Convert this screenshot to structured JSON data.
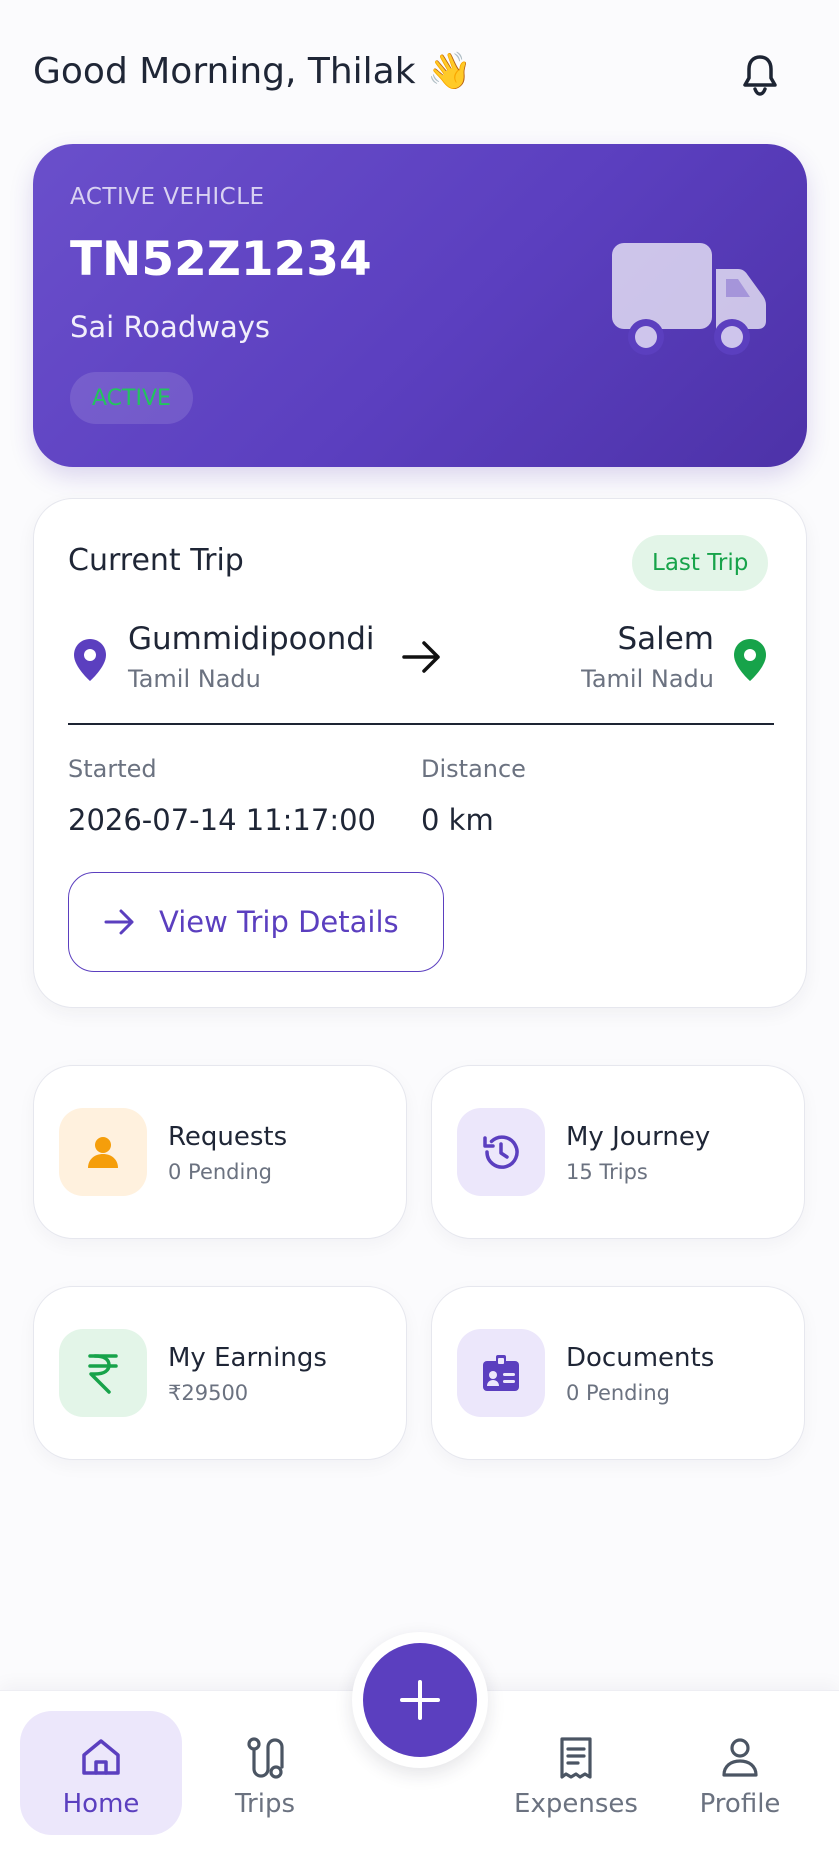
{
  "header": {
    "greeting": "Good Morning, Thilak",
    "wave_emoji": "👋",
    "notification_icon": "bell-icon"
  },
  "vehicle": {
    "label": "ACTIVE VEHICLE",
    "number": "TN52Z1234",
    "owner": "Sai Roadways",
    "status": "ACTIVE",
    "icon": "truck-icon"
  },
  "current_trip": {
    "title": "Current Trip",
    "badge": "Last Trip",
    "from_city": "Gummidipoondi",
    "from_state": "Tamil Nadu",
    "to_city": "Salem",
    "to_state": "Tamil Nadu",
    "started_label": "Started",
    "started_value": "2026-07-14 11:17:00",
    "distance_label": "Distance",
    "distance_value": "0 km",
    "view_button": "View Trip Details"
  },
  "tiles": [
    {
      "title": "Requests",
      "subtitle": "0 Pending",
      "icon": "person-icon"
    },
    {
      "title": "My Journey",
      "subtitle": "15 Trips",
      "icon": "history-icon"
    },
    {
      "title": "My Earnings",
      "subtitle": "₹29500",
      "icon": "rupee-icon"
    },
    {
      "title": "Documents",
      "subtitle": "0 Pending",
      "icon": "id-card-icon"
    }
  ],
  "bottom_nav": {
    "items": [
      {
        "label": "Home",
        "icon": "home-icon",
        "active": true
      },
      {
        "label": "Trips",
        "icon": "route-icon"
      },
      {
        "label": "Expenses",
        "icon": "receipt-icon"
      },
      {
        "label": "Profile",
        "icon": "user-icon"
      }
    ],
    "fab_icon": "plus-icon"
  },
  "colors": {
    "primary": "#5b3fbf",
    "success": "#17a34a",
    "orange": "#f59e0b",
    "background": "#fbfbfd"
  }
}
